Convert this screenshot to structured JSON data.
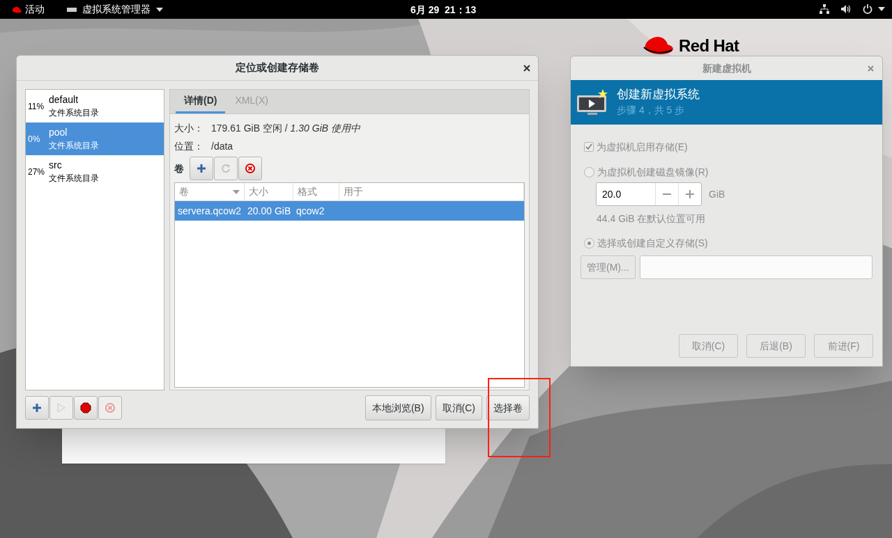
{
  "top_bar": {
    "activities": "活动",
    "app_menu": "虚拟系统管理器",
    "clock": "6月 29  21：13"
  },
  "desktop": {
    "logo_text": "Red Hat"
  },
  "storage_dialog": {
    "title": "定位或创建存储卷",
    "pools": [
      {
        "usage": "11%",
        "name": "default",
        "type": "文件系统目录",
        "selected": false
      },
      {
        "usage": "0%",
        "name": "pool",
        "type": "文件系统目录",
        "selected": true
      },
      {
        "usage": "27%",
        "name": "src",
        "type": "文件系统目录",
        "selected": false
      }
    ],
    "tabs": [
      {
        "label": "详情(D)",
        "selected": true
      },
      {
        "label": "XML(X)",
        "selected": false
      }
    ],
    "size_label": "大小：",
    "size_value": "179.61 GiB 空闲 / *1.30 GiB 使用中*",
    "location_label": "位置：",
    "location_value": "/data",
    "volumes_label": "卷",
    "volume_tools": [
      {
        "kind": "add",
        "disabled": false
      },
      {
        "kind": "refresh",
        "disabled": true
      },
      {
        "kind": "delete",
        "disabled": false
      }
    ],
    "columns": [
      "卷",
      "大小",
      "格式",
      "用于"
    ],
    "rows": [
      {
        "name": "servera.qcow2",
        "size": "20.00 GiB",
        "format": "qcow2",
        "selected": true
      }
    ],
    "pool_tools": [
      {
        "kind": "add",
        "disabled": false
      },
      {
        "kind": "start",
        "disabled": true
      },
      {
        "kind": "stop",
        "disabled": false
      },
      {
        "kind": "delete",
        "disabled": true
      }
    ],
    "buttons": [
      "本地浏览(B)",
      "取消(C)",
      "选择卷"
    ]
  },
  "new_vm": {
    "title": "新建虚拟机",
    "header_title": "创建新虚拟系统",
    "header_step": "步骤 4，共 5 步",
    "enable_storage": {
      "label": "为虚拟机启用存储(E)",
      "checked": true
    },
    "options": [
      {
        "label": "为虚拟机创建磁盘镜像(R)",
        "selected": false
      },
      {
        "label": "选择或创建自定义存储(S)",
        "selected": true
      }
    ],
    "disk_size": "20.0",
    "unit": "GiB",
    "available": "44.4 GiB 在默认位置可用",
    "manage_button": "管理(M)...",
    "buttons": [
      "取消(C)",
      "后退(B)",
      "前进(F)"
    ]
  }
}
